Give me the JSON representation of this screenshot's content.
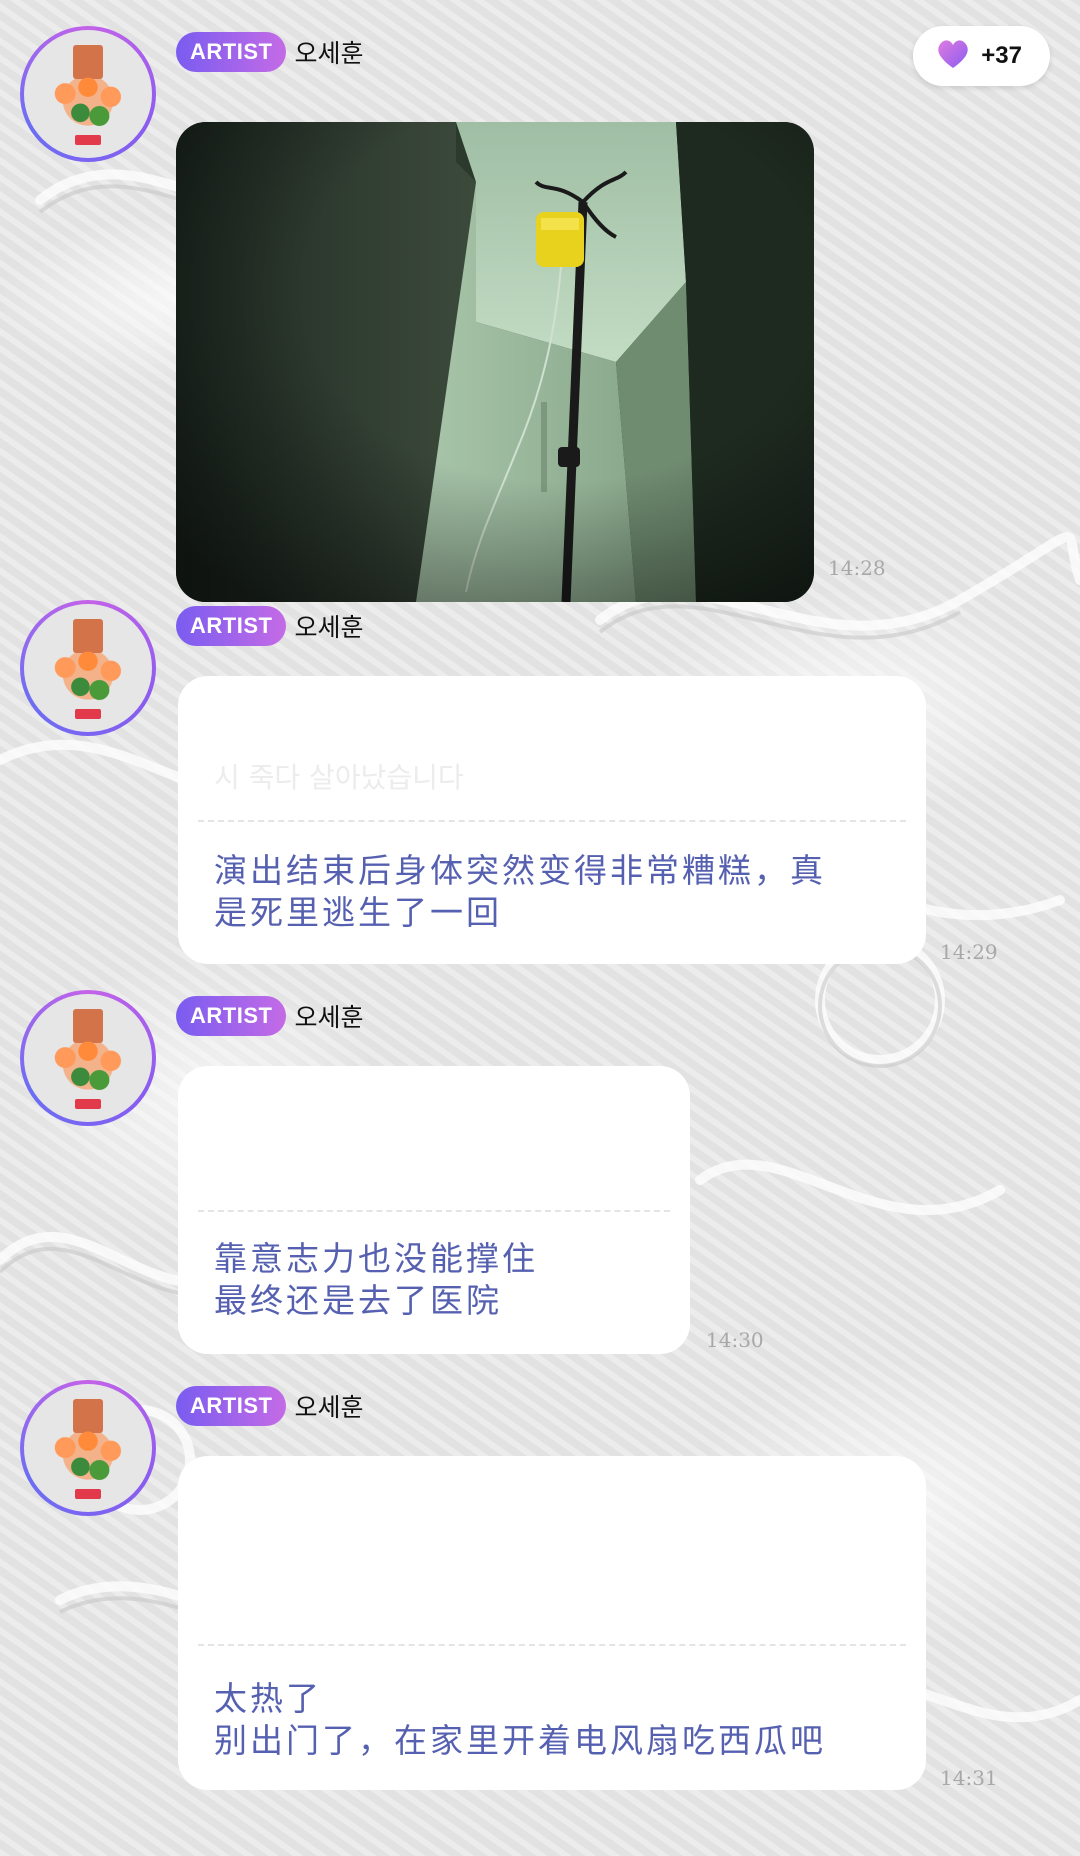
{
  "likes": {
    "count": "+37",
    "icon": "heart-icon",
    "color": "#b46be8"
  },
  "messages": [
    {
      "badge": "ARTIST",
      "sender": "오세훈",
      "type": "photo",
      "time": "14:28",
      "photo_subject": "hospital IV drip stand"
    },
    {
      "badge": "ARTIST",
      "sender": "오세훈",
      "type": "text",
      "faded_korean": "시 죽다 살아났습니다",
      "text": "演出结束后身体突然变得非常糟糕，真\n是死里逃生了一回",
      "time": "14:29"
    },
    {
      "badge": "ARTIST",
      "sender": "오세훈",
      "type": "text",
      "faded_korean": "",
      "text": "靠意志力也没能撑住\n最终还是去了医院",
      "time": "14:30"
    },
    {
      "badge": "ARTIST",
      "sender": "오세훈",
      "type": "text",
      "faded_korean": "",
      "text": "太热了\n别出门了，在家里开着电风扇吃西瓜吧",
      "time": "14:31"
    }
  ],
  "colors": {
    "badge_start": "#7a5cf0",
    "badge_end": "#c46be6",
    "translation_text": "#5660b0",
    "timestamp": "#a8a8a8"
  }
}
